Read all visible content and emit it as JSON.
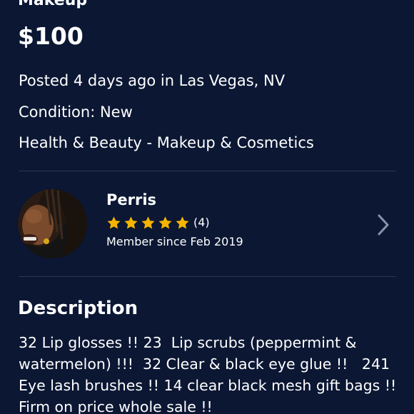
{
  "listing": {
    "title": "Makeup",
    "price": "$100",
    "posted": "Posted 4 days ago in Las Vegas, NV",
    "condition": "Condition: New",
    "category": "Health & Beauty - Makeup & Cosmetics"
  },
  "seller": {
    "name": "Perris",
    "rating": 5,
    "rating_count": "(4)",
    "member_since": "Member since Feb 2019"
  },
  "description": {
    "heading": "Description",
    "body": "32 Lip glosses !! 23  Lip scrubs (peppermint & watermelon) !!!  32 Clear & black eye glue !!   241 Eye lash brushes !! 14 clear black mesh gift bags !! Firm on price whole sale !!"
  },
  "colors": {
    "background": "#0b1733",
    "star": "#f5b400",
    "divider": "#2b3752"
  },
  "icons": {
    "star": "star-icon",
    "chevron": "chevron-right-icon"
  }
}
